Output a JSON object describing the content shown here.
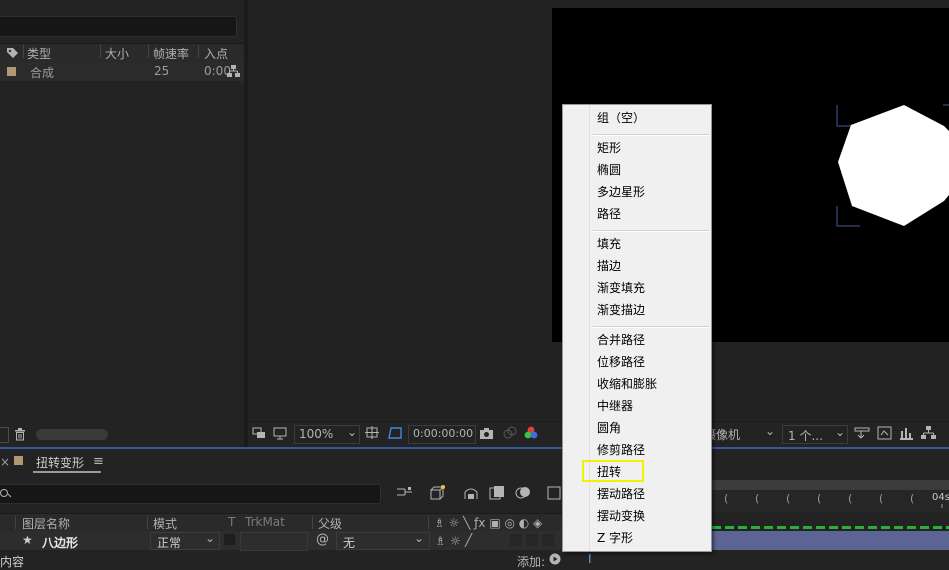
{
  "project_panel": {
    "columns": {
      "type": "类型",
      "size": "大小",
      "framerate": "帧速率",
      "in_point": "入点"
    },
    "item": {
      "type": "合成",
      "framerate": "25",
      "in_point": "0:00"
    }
  },
  "viewer": {
    "zoom": "100%",
    "timecode": "0:00:00:00",
    "camera": "摄像机",
    "views": "1 个..."
  },
  "timeline": {
    "tab_name": "扭转变形",
    "columns": {
      "layer_name": "图层名称",
      "mode": "模式",
      "t": "T",
      "trkmat": "TrkMat",
      "parent": "父级"
    },
    "layer": {
      "name": "八边形",
      "mode": "正常",
      "parent": "无"
    },
    "sub_row": {
      "content": "内容",
      "add_label": "添加:"
    },
    "ruler_end": "04s"
  },
  "context_menu": {
    "groups": [
      [
        "组（空）"
      ],
      [
        "矩形",
        "椭圆",
        "多边星形",
        "路径"
      ],
      [
        "填充",
        "描边",
        "渐变填充",
        "渐变描边"
      ],
      [
        "合并路径",
        "位移路径",
        "收缩和膨胀",
        "中继器",
        "圆角",
        "修剪路径",
        "扭转",
        "摆动路径",
        "摆动变换",
        "Z 字形"
      ]
    ],
    "highlighted": "扭转",
    "highlight_color": "#f2f200"
  },
  "colors": {
    "accent_blue": "#2e5a9a",
    "layer_bar": "#5c6494",
    "label_tan": "#b19872",
    "green_track": "#27b03a"
  }
}
